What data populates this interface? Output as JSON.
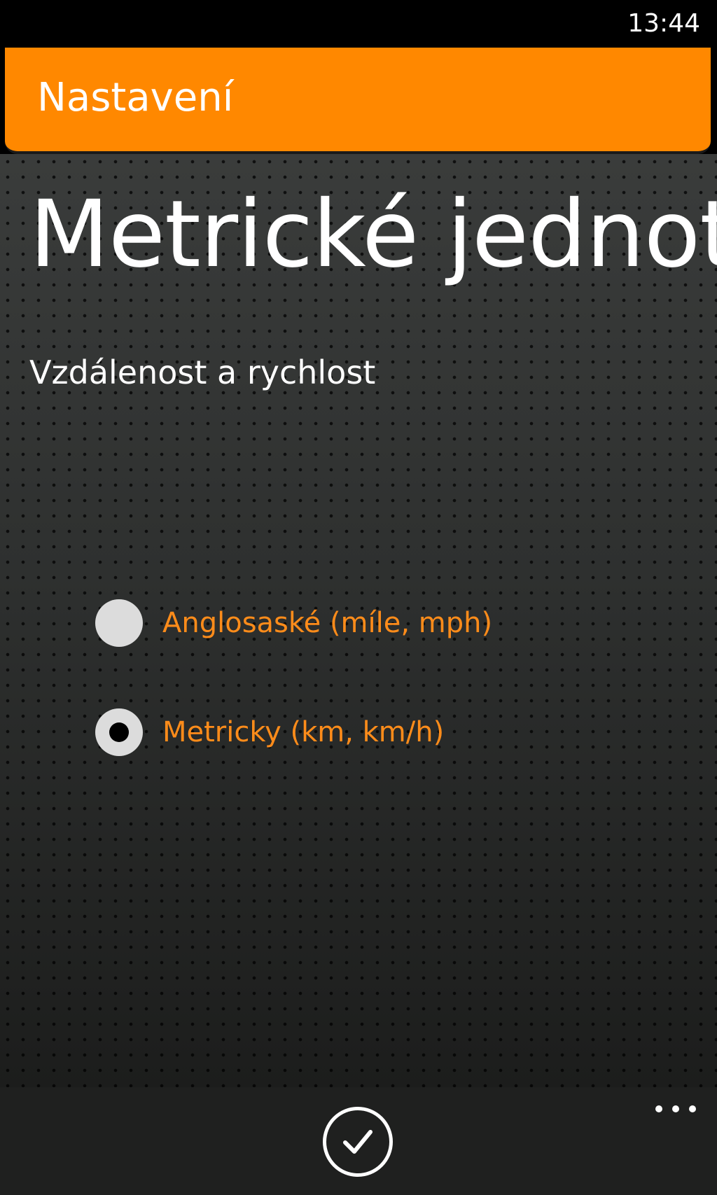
{
  "status_bar": {
    "time": "13:44"
  },
  "header": {
    "title": "Nastavení",
    "color": "#ff8800"
  },
  "page": {
    "heading": "Metrické jednotky",
    "group_label": "Vzdálenost a rychlost"
  },
  "options": [
    {
      "label": "Anglosaské (míle, mph)",
      "selected": false
    },
    {
      "label": "Metricky (km, km/h)",
      "selected": true
    }
  ],
  "app_bar": {
    "confirm_icon": "check-icon",
    "more_icon": "ellipsis-icon"
  },
  "colors": {
    "accent": "#ff8800",
    "option_text": "#ff8c1a",
    "background": "#2a2c2b"
  }
}
